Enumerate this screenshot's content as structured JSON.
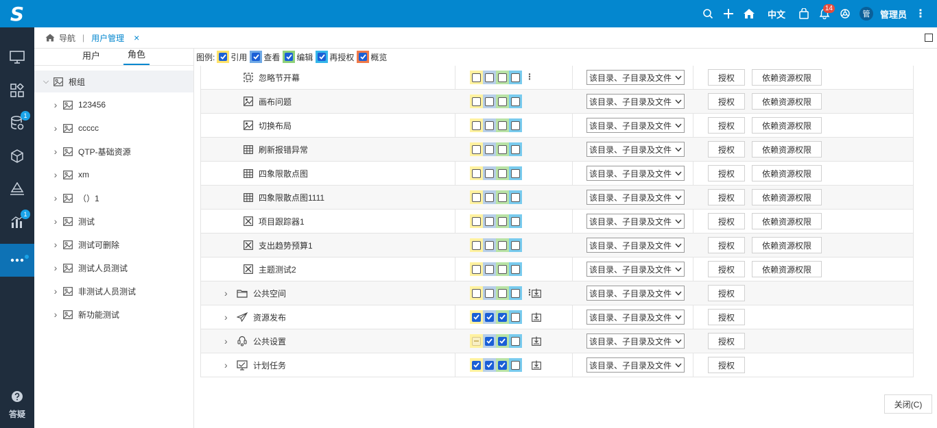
{
  "topbar": {
    "logo": "S",
    "language": "中文",
    "notification_count": "14",
    "avatar_text": "管",
    "username": "管理员"
  },
  "sidenav": {
    "badges": [
      "1",
      "1"
    ],
    "help_label": "答疑"
  },
  "tabs": {
    "home_label": "导航",
    "current_label": "用户管理",
    "close_glyph": "×"
  },
  "left_panel": {
    "tabs": [
      {
        "label": "用户",
        "active": false
      },
      {
        "label": "角色",
        "active": true
      }
    ],
    "tree": [
      {
        "label": "根组",
        "expanded": true,
        "level": 0
      },
      {
        "label": "123456",
        "level": 1
      },
      {
        "label": "ccccc",
        "level": 1
      },
      {
        "label": "QTP-基础资源",
        "level": 1
      },
      {
        "label": "xm",
        "level": 1
      },
      {
        "label": "（）1",
        "level": 1
      },
      {
        "label": "测试",
        "level": 1
      },
      {
        "label": "测试可删除",
        "level": 1
      },
      {
        "label": "测试人员测试",
        "level": 1
      },
      {
        "label": "非测试人员测试",
        "level": 1
      },
      {
        "label": "新功能测试",
        "level": 1
      }
    ]
  },
  "legend": {
    "prefix": "图例:",
    "items": [
      {
        "label": "引用",
        "color": "#ffe36b"
      },
      {
        "label": "查看",
        "color": "#6fa9e6"
      },
      {
        "label": "编辑",
        "color": "#8fd17a"
      },
      {
        "label": "再授权",
        "color": "#35b6ea"
      },
      {
        "label": "概览",
        "color": "#f07a4a"
      }
    ]
  },
  "column_colors": [
    "#fff2a0",
    "#b7cfe9",
    "#b9e3a6",
    "#79cbee"
  ],
  "rows": [
    {
      "name": "忽略节开幕",
      "icon": "dashboard-icon",
      "level": 2,
      "checks": [
        false,
        false,
        false,
        false
      ],
      "more": true,
      "inherit": false,
      "scope": "该目录、子目录及文件",
      "auth": "授权",
      "dep": "依赖资源权限"
    },
    {
      "name": "画布问题",
      "icon": "canvas-icon",
      "level": 2,
      "checks": [
        false,
        false,
        false,
        false
      ],
      "more": false,
      "inherit": false,
      "scope": "该目录、子目录及文件",
      "auth": "授权",
      "dep": "依赖资源权限"
    },
    {
      "name": "切换布局",
      "icon": "canvas-icon",
      "level": 2,
      "checks": [
        false,
        false,
        false,
        false
      ],
      "more": false,
      "inherit": false,
      "scope": "该目录、子目录及文件",
      "auth": "授权",
      "dep": "依赖资源权限"
    },
    {
      "name": "刷新报错异常",
      "icon": "table-icon",
      "level": 2,
      "checks": [
        false,
        false,
        false,
        false
      ],
      "more": false,
      "inherit": false,
      "scope": "该目录、子目录及文件",
      "auth": "授权",
      "dep": "依赖资源权限"
    },
    {
      "name": "四象限散点图",
      "icon": "table-icon",
      "level": 2,
      "checks": [
        false,
        false,
        false,
        false
      ],
      "more": false,
      "inherit": false,
      "scope": "该目录、子目录及文件",
      "auth": "授权",
      "dep": "依赖资源权限"
    },
    {
      "name": "四象限散点图1111",
      "icon": "table-icon",
      "level": 2,
      "checks": [
        false,
        false,
        false,
        false
      ],
      "more": false,
      "inherit": false,
      "scope": "该目录、子目录及文件",
      "auth": "授权",
      "dep": "依赖资源权限"
    },
    {
      "name": "项目跟踪器1",
      "icon": "report-icon",
      "level": 2,
      "checks": [
        false,
        false,
        false,
        false
      ],
      "more": false,
      "inherit": false,
      "scope": "该目录、子目录及文件",
      "auth": "授权",
      "dep": "依赖资源权限"
    },
    {
      "name": "支出趋势预算1",
      "icon": "report-icon",
      "level": 2,
      "checks": [
        false,
        false,
        false,
        false
      ],
      "more": false,
      "inherit": false,
      "scope": "该目录、子目录及文件",
      "auth": "授权",
      "dep": "依赖资源权限"
    },
    {
      "name": "主题测试2",
      "icon": "report-icon",
      "level": 2,
      "checks": [
        false,
        false,
        false,
        false
      ],
      "more": false,
      "inherit": false,
      "scope": "该目录、子目录及文件",
      "auth": "授权",
      "dep": "依赖资源权限"
    },
    {
      "name": "公共空间",
      "icon": "folder-icon",
      "level": 1,
      "checks": [
        false,
        false,
        false,
        false
      ],
      "more": true,
      "inherit": true,
      "scope": "该目录、子目录及文件",
      "auth": "授权",
      "dep": ""
    },
    {
      "name": "资源发布",
      "icon": "send-icon",
      "level": 1,
      "checks": [
        true,
        true,
        true,
        false
      ],
      "more": false,
      "inherit": true,
      "scope": "该目录、子目录及文件",
      "auth": "授权",
      "dep": ""
    },
    {
      "name": "公共设置",
      "icon": "settings-icon",
      "level": 1,
      "checks": [
        "half",
        true,
        true,
        false
      ],
      "more": false,
      "inherit": true,
      "scope": "该目录、子目录及文件",
      "auth": "授权",
      "dep": ""
    },
    {
      "name": "计划任务",
      "icon": "schedule-icon",
      "level": 1,
      "checks": [
        true,
        true,
        true,
        false
      ],
      "more": false,
      "inherit": true,
      "scope": "该目录、子目录及文件",
      "auth": "授权",
      "dep": ""
    }
  ],
  "footer": {
    "close_label": "关闭(C)"
  }
}
